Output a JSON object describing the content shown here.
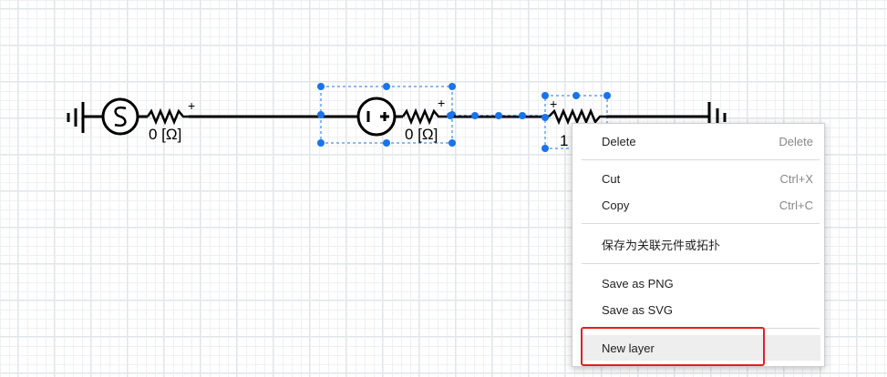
{
  "circuit": {
    "source_resistance_label": "0 [Ω]",
    "dc_source_resistance_label": "0 [Ω]",
    "third_component_label": "1",
    "plus_sign": "+"
  },
  "context_menu": {
    "items": [
      {
        "label": "Delete",
        "shortcut": "Delete"
      },
      {
        "label": "Cut",
        "shortcut": "Ctrl+X"
      },
      {
        "label": "Copy",
        "shortcut": "Ctrl+C"
      },
      {
        "label": "保存为关联元件或拓扑",
        "shortcut": ""
      },
      {
        "label": "Save as PNG",
        "shortcut": ""
      },
      {
        "label": "Save as SVG",
        "shortcut": ""
      },
      {
        "label": "New layer",
        "shortcut": ""
      }
    ]
  },
  "colors": {
    "selection": "#1a73e8",
    "highlight_border": "#e02020",
    "wire": "#000000"
  }
}
